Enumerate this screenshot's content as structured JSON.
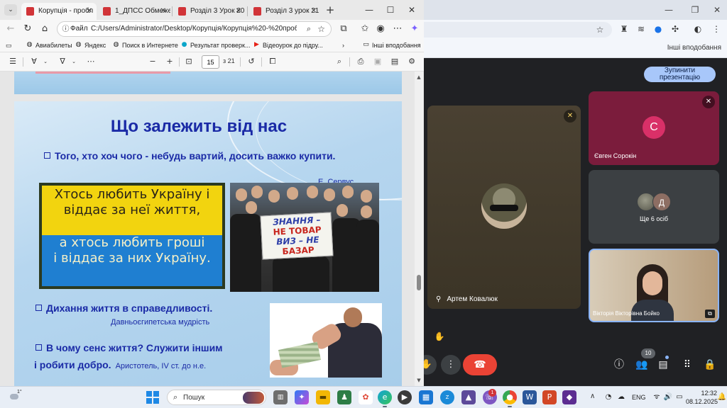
{
  "edge": {
    "tabs": [
      {
        "title": "Корупція - пробл"
      },
      {
        "title": "1_ДПСС Обмеже"
      },
      {
        "title": "Розділ 3 Урок 20 С"
      },
      {
        "title": "Розділ 3 урок 21 в"
      }
    ],
    "address": {
      "scheme_label": "Файл",
      "url": "C:/Users/Administrator/Desktop/Корупція/Корупція%20-%20пробл"
    },
    "bookmarks": [
      {
        "label": "Авиабилеты"
      },
      {
        "label": "Яндекс"
      },
      {
        "label": "Поиск в Интернете"
      },
      {
        "label": "Результат проверк..."
      },
      {
        "label": "Відеоурок до підру..."
      }
    ],
    "other_bookmarks": "Інші вподобання",
    "pdf_toolbar": {
      "zoom_out": "−",
      "zoom_in": "+",
      "page_current": "15",
      "page_total": "з 21"
    }
  },
  "slide": {
    "title": "Що  залежить від нас",
    "bullet1": "Того, хто хоч чого - небудь вартий, досить важко купити.",
    "bullet1_author": "Е. Сервус",
    "flag_lines": [
      "Хтось любить Україну і",
      "віддає за неї життя,",
      "а хтось любить гроші",
      "і віддає за них Україну."
    ],
    "sign_lines": [
      "ЗНАННЯ –",
      "НЕ ТОВАР",
      "ВИЗ – НЕ",
      "БАЗАР"
    ],
    "bullet2": "Дихання життя в справедливості.",
    "bullet2_author": "Давньоєгипетська мудрість",
    "bullet3": "В чому сенс  життя?  Служити іншим",
    "bullet3_line2": "і  робити  добро.",
    "bullet3_author": "Аристотель,  IV ст. до н.е."
  },
  "meet": {
    "stop_presenting": [
      "Зупинити",
      "презентацію"
    ],
    "main_participant": "Артем Ковалюк",
    "participant2": {
      "name": "Євген Сорокін",
      "initial": "С"
    },
    "more_tile": {
      "initial": "Д",
      "label": "Ще 6 осіб"
    },
    "self_name": "Вікторія Вікторівна Бойко",
    "people_count": "10"
  },
  "bg_chrome": {
    "other_bookmarks": "Інші вподобання"
  },
  "taskbar": {
    "weather_temp": "1°",
    "search_placeholder": "Пошук",
    "notification_count": "1",
    "language": "ENG",
    "time": "12:32",
    "date": "08.12.2025"
  }
}
